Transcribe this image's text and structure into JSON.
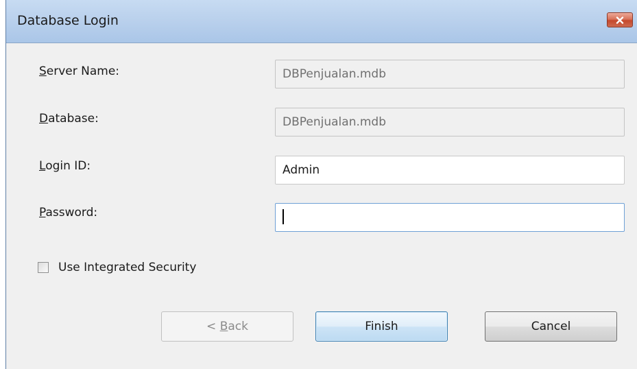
{
  "window": {
    "title": "Database Login"
  },
  "icons": {
    "close": "close-icon"
  },
  "form": {
    "server_name": {
      "label_first": "S",
      "label_rest": "erver Name:",
      "value": "DBPenjualan.mdb",
      "enabled": false
    },
    "database": {
      "label_first": "D",
      "label_rest": "atabase:",
      "value": "DBPenjualan.mdb",
      "enabled": false
    },
    "login_id": {
      "label_first": "L",
      "label_rest": "ogin ID:",
      "value": "Admin",
      "enabled": true
    },
    "password": {
      "label_first": "P",
      "label_rest": "assword:",
      "value": "",
      "enabled": true,
      "focused": true
    },
    "integrated_security": {
      "label": "Use Integrated Security",
      "checked": false
    }
  },
  "buttons": {
    "back_prefix": "< ",
    "back_key": "B",
    "back_rest": "ack",
    "back_enabled": false,
    "finish": "Finish",
    "cancel": "Cancel"
  },
  "colors": {
    "titlebar": "#b9d0ec",
    "close_button": "#c4482c",
    "dialog_background": "#f0f0f0",
    "focus_border": "#6ea0d6",
    "default_button_border": "#3c7fb1"
  }
}
